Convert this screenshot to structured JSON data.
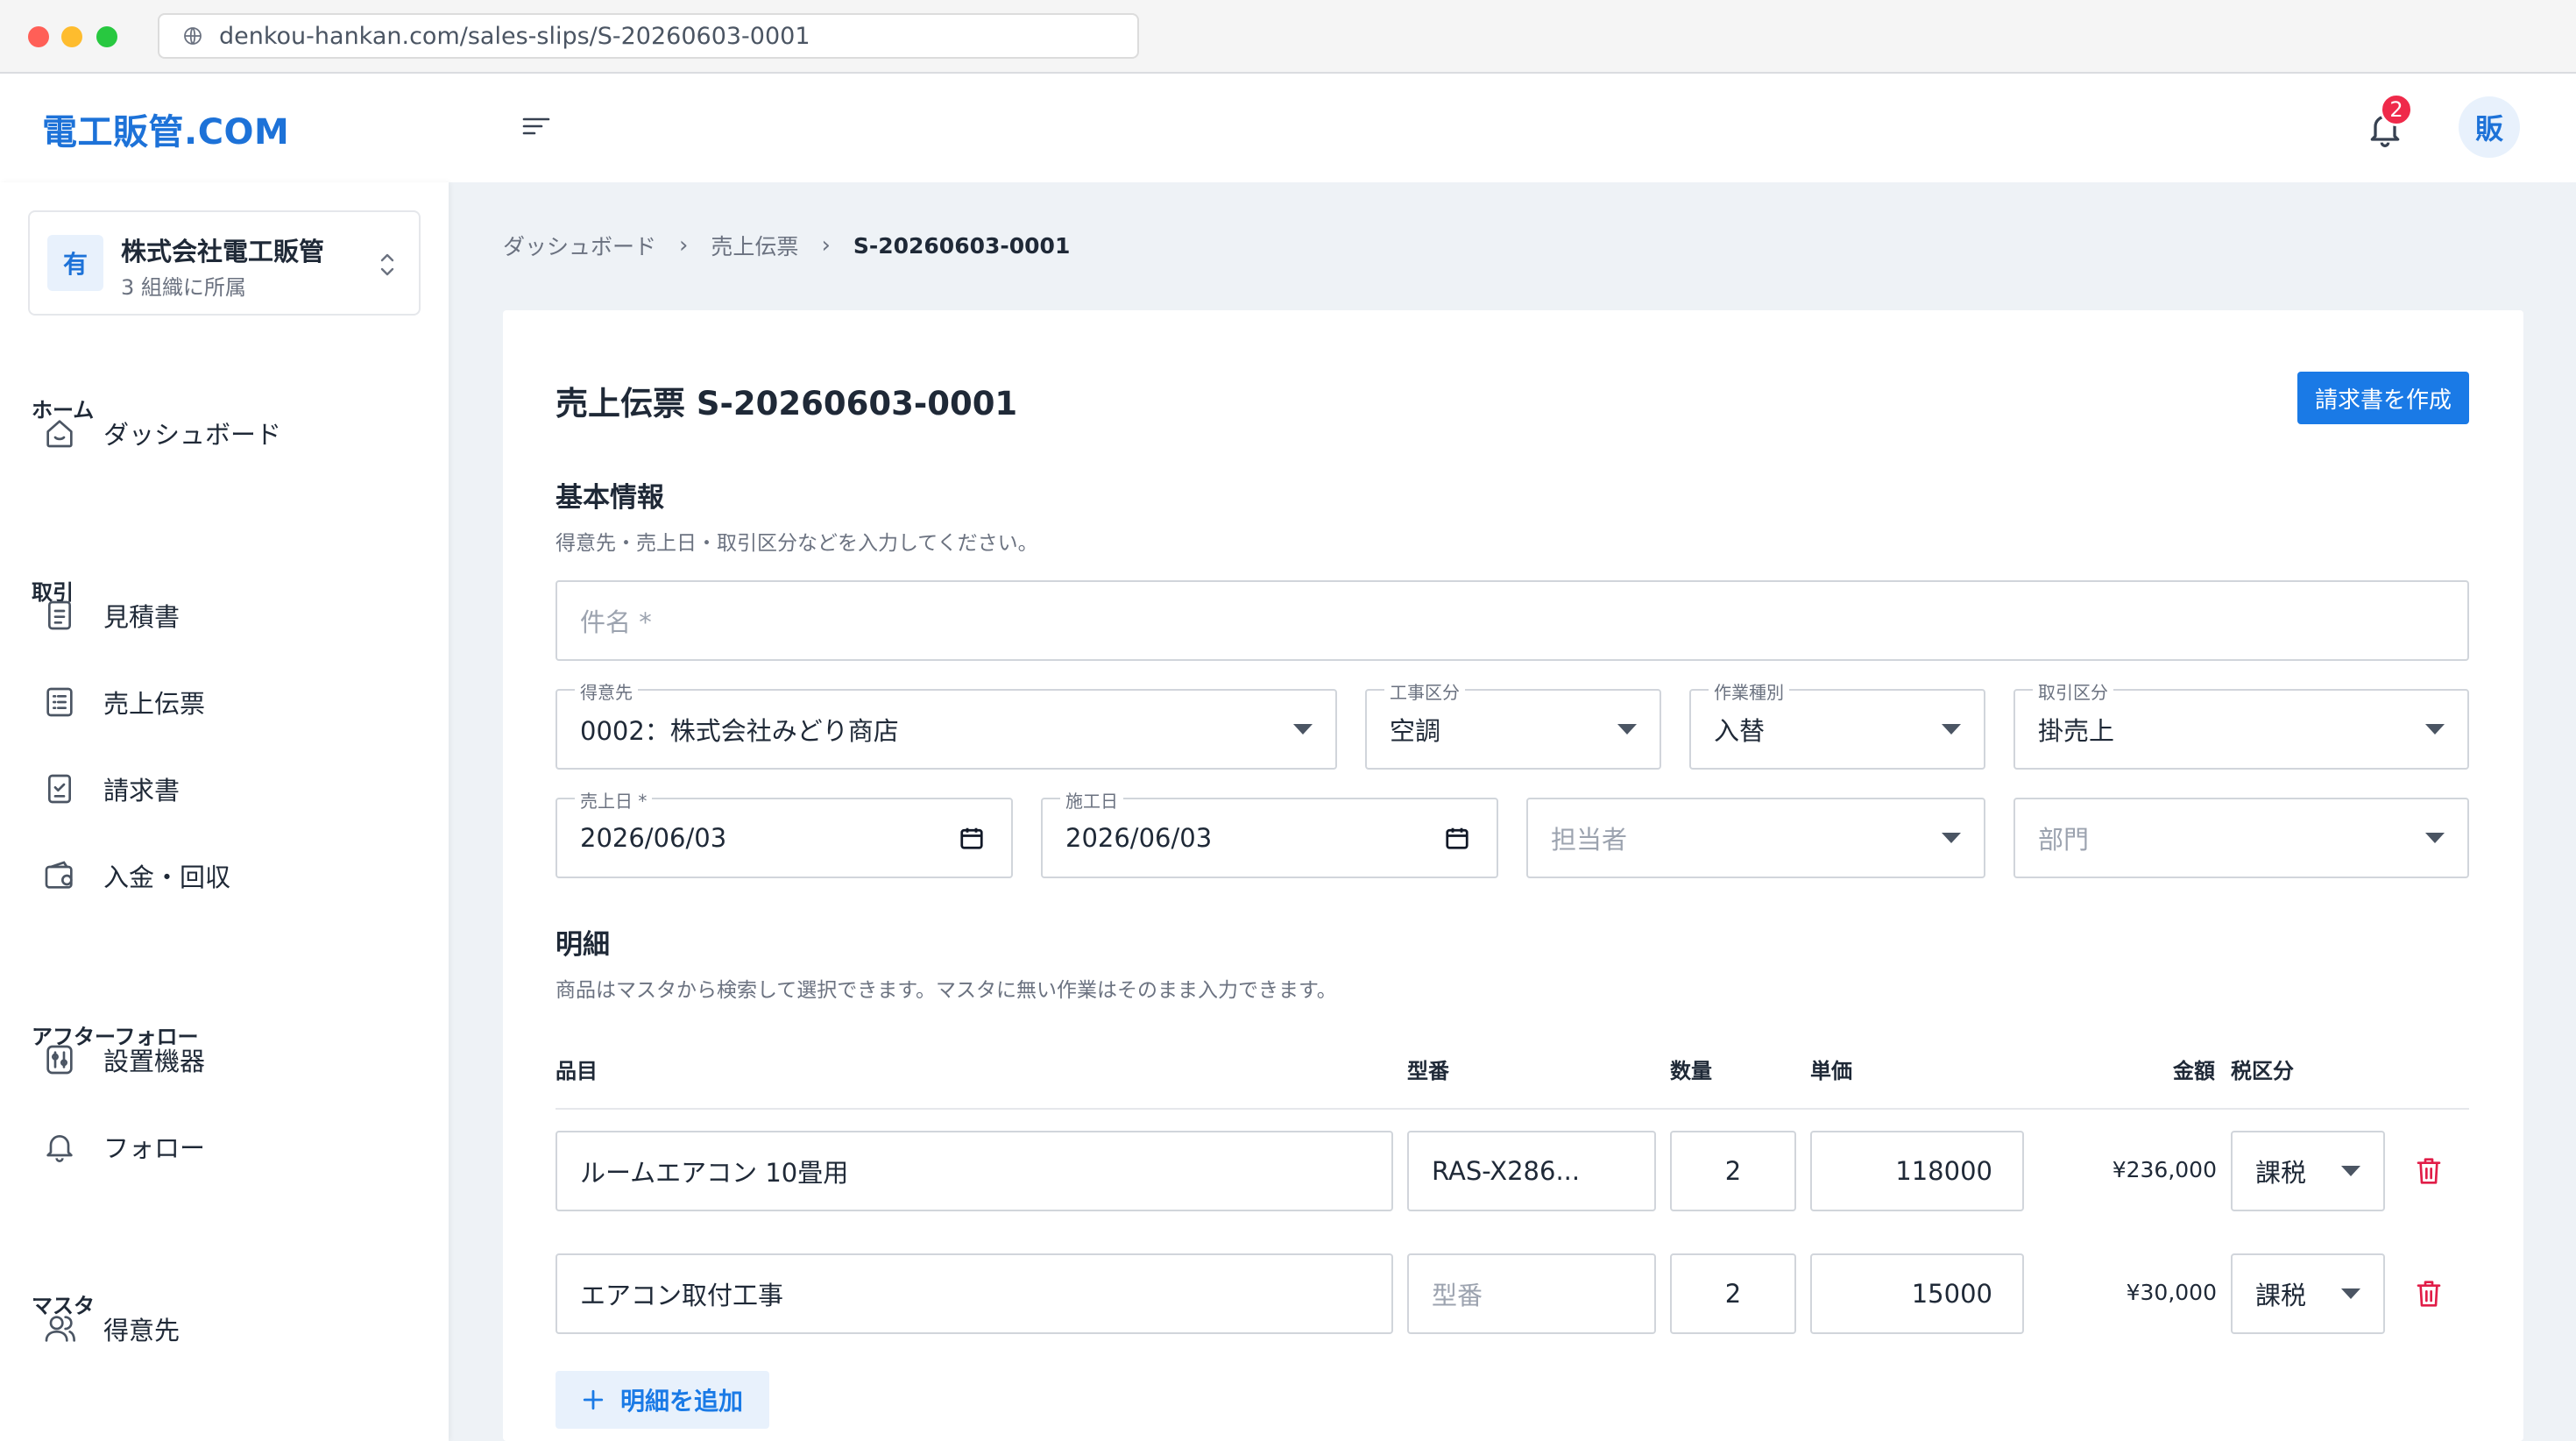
{
  "browser": {
    "url": "denkou-hankan.com/sales-slips/S-20260603-0001"
  },
  "header": {
    "logo": "電工販管.COM",
    "notification_count": "2",
    "avatar_initial": "販"
  },
  "org": {
    "mark": "有",
    "name": "株式会社電工販管",
    "sub": "3 組織に所属"
  },
  "sidebar": {
    "sections": [
      "ホーム",
      "取引",
      "アフターフォロー",
      "マスタ"
    ],
    "items": [
      "ダッシュボード",
      "見積書",
      "売上伝票",
      "請求書",
      "入金・回収",
      "設置機器",
      "フォロー",
      "得意先"
    ]
  },
  "breadcrumb": [
    "ダッシュボード",
    "売上伝票",
    "S-20260603-0001"
  ],
  "page": {
    "title": "売上伝票 S-20260603-0001",
    "invoice_button": "請求書を作成"
  },
  "basic": {
    "title": "基本情報",
    "desc": "得意先・売上日・取引区分などを入力してください。",
    "subject_placeholder": "件名 *",
    "customer_label": "得意先",
    "customer_value": "0002：株式会社みどり商店",
    "construction_label": "工事区分",
    "construction_value": "空調",
    "work_label": "作業種別",
    "work_value": "入替",
    "trade_label": "取引区分",
    "trade_value": "掛売上",
    "sales_date_label": "売上日 *",
    "sales_date_value": "2026/06/03",
    "work_date_label": "施工日",
    "work_date_value": "2026/06/03",
    "staff_placeholder": "担当者",
    "dept_placeholder": "部門"
  },
  "details": {
    "title": "明細",
    "desc": "商品はマスタから検索して選択できます。マスタに無い作業はそのまま入力できます。",
    "columns": {
      "item": "品目",
      "model": "型番",
      "qty": "数量",
      "price": "単価",
      "amount": "金額",
      "tax": "税区分"
    },
    "model_placeholder": "型番",
    "rows": [
      {
        "item": "ルームエアコン 10畳用",
        "model": "RAS-X286...",
        "qty": "2",
        "price": "118000",
        "amount": "¥236,000",
        "tax": "課税"
      },
      {
        "item": "エアコン取付工事",
        "model": "",
        "qty": "2",
        "price": "15000",
        "amount": "¥30,000",
        "tax": "課税"
      }
    ],
    "add_button": "明細を追加"
  },
  "colors": {
    "accent": "#1a7ae6",
    "logo": "#1d72d8",
    "danger": "#e11d48",
    "badge": "#ef2a4a"
  }
}
